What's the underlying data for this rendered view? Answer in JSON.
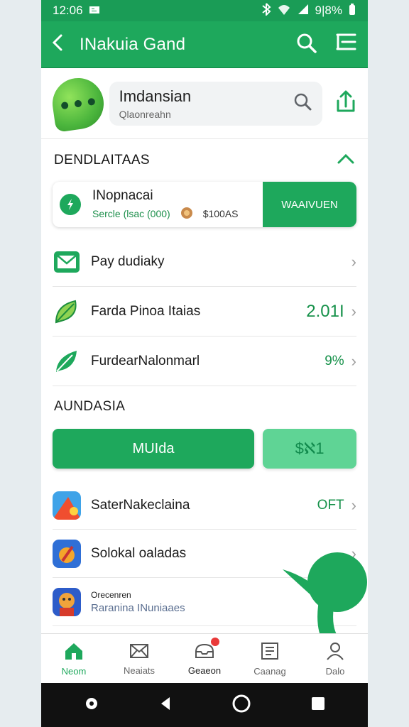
{
  "status": {
    "time": "12:06",
    "battery": "9|8%"
  },
  "appbar": {
    "title": "INakuia Gand"
  },
  "profile": {
    "name": "Imdansian",
    "subtitle": "Qlaonreahn"
  },
  "section1": {
    "title": "DENDLAITAAS"
  },
  "promo": {
    "title": "INopnacai",
    "detail": "Sercle (lsac (000)",
    "amount": "$100AS",
    "cta": "WAAIVUEN"
  },
  "list": [
    {
      "label": "Pay dudiaky",
      "value": ""
    },
    {
      "label": "Farda Pinoa Itaias",
      "value": "2.01I"
    },
    {
      "label": "FurdearNalonmarl",
      "value": "9%"
    }
  ],
  "section2": {
    "title": "AUNDASIA"
  },
  "actions": {
    "primary": "MUIda",
    "secondary": "$ℵ1"
  },
  "apps": [
    {
      "label": "SaterNakeclaina",
      "value": "OFT"
    },
    {
      "label": "Solokal oaladas",
      "value": ""
    },
    {
      "top": "Orecenren",
      "bottom": "Raranina INuniaaes"
    }
  ],
  "nav": [
    {
      "label": "Neom"
    },
    {
      "label": "Neaiats"
    },
    {
      "label": "Geaeon"
    },
    {
      "label": "Caanag"
    },
    {
      "label": "Dalo"
    }
  ],
  "colors": {
    "brand": "#1ea85c",
    "badge": "#e93939"
  },
  "icons": [
    "back-icon",
    "search-icon",
    "menu-icon",
    "share-icon",
    "chevron-up-icon",
    "mail-icon",
    "leaf-icon",
    "home-icon",
    "inbox-icon",
    "document-icon",
    "profile-icon"
  ]
}
